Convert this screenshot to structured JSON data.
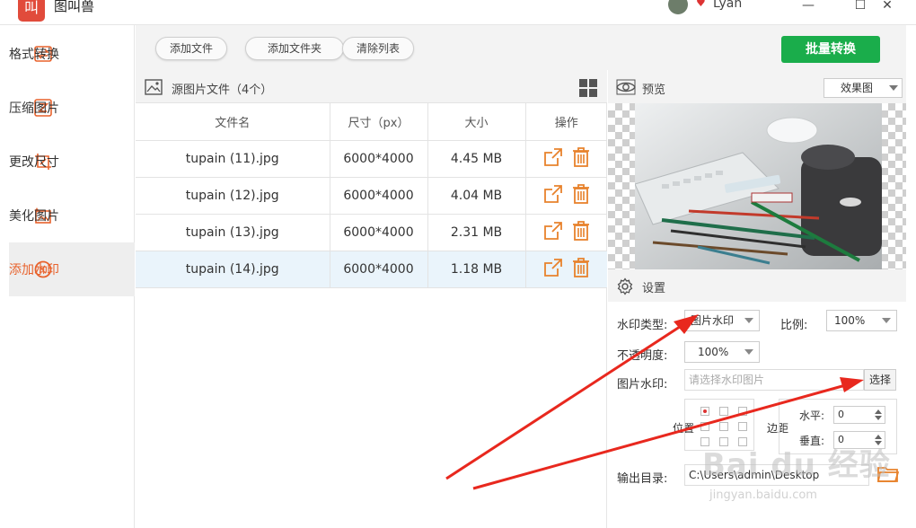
{
  "window": {
    "app_title": "图叫兽",
    "app_logo_glyph": "叫",
    "user_name": "Lyan",
    "minimize_glyph": "—",
    "maximize_glyph": "☐",
    "close_glyph": "✕"
  },
  "sidebar": {
    "items": [
      {
        "label": "格式转换",
        "icon": "format-convert-icon"
      },
      {
        "label": "压缩图片",
        "icon": "compress-icon"
      },
      {
        "label": "更改尺寸",
        "icon": "resize-icon"
      },
      {
        "label": "美化图片",
        "icon": "beautify-icon"
      },
      {
        "label": "添加水印",
        "icon": "watermark-icon",
        "active": true
      }
    ]
  },
  "toolbar": {
    "add_file": "添加文件",
    "add_folder": "添加文件夹",
    "clear_list": "清除列表",
    "batch_convert": "批量转换"
  },
  "file_list": {
    "title": "源图片文件（4个）",
    "columns": [
      "文件名",
      "尺寸（px）",
      "大小",
      "操作"
    ],
    "rows": [
      {
        "name": "tupain (11).jpg",
        "size_px": "6000*4000",
        "size": "4.45 MB"
      },
      {
        "name": "tupain (12).jpg",
        "size_px": "6000*4000",
        "size": "4.04 MB"
      },
      {
        "name": "tupain (13).jpg",
        "size_px": "6000*4000",
        "size": "2.31 MB"
      },
      {
        "name": "tupain (14).jpg",
        "size_px": "6000*4000",
        "size": "1.18 MB",
        "selected": true
      }
    ]
  },
  "preview": {
    "title": "预览",
    "mode": "效果图"
  },
  "settings": {
    "title": "设置",
    "watermark_type_label": "水印类型:",
    "watermark_type_value": "图片水印",
    "ratio_label": "比例:",
    "ratio_value": "100%",
    "opacity_label": "不透明度:",
    "opacity_value": "100%",
    "image_watermark_label": "图片水印:",
    "image_watermark_placeholder": "请选择水印图片",
    "choose_button": "选择",
    "position_label": "位置",
    "margin_label": "边距",
    "horizontal_label": "水平:",
    "horizontal_value": "0",
    "vertical_label": "垂直:",
    "vertical_value": "0",
    "output_dir_label": "输出目录:",
    "output_dir_value": "C:\\Users\\admin\\Desktop"
  },
  "watermark_overlay": {
    "brand": "Bai du 经验",
    "url": "jingyan.baidu.com"
  },
  "colors": {
    "accent_orange": "#e8622c",
    "batch_green": "#1aad4b",
    "arrow_red": "#e8281e"
  }
}
